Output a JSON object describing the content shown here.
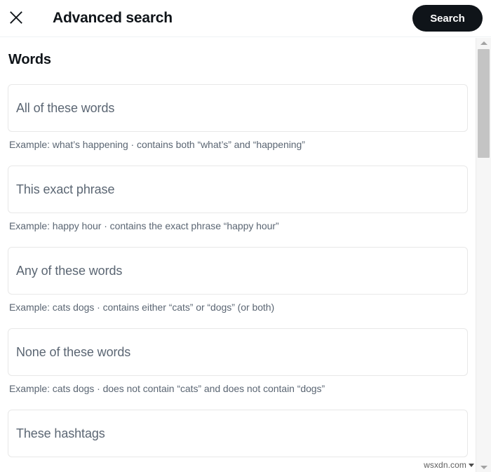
{
  "header": {
    "title": "Advanced search",
    "close_icon": "close-icon",
    "search_button_label": "Search"
  },
  "sections": [
    {
      "title": "Words",
      "fields": [
        {
          "name": "all-of-these-words",
          "placeholder": "All of these words",
          "value": "",
          "hint": "Example: what’s happening · contains both “what’s” and “happening”"
        },
        {
          "name": "this-exact-phrase",
          "placeholder": "This exact phrase",
          "value": "",
          "hint": "Example: happy hour · contains the exact phrase “happy hour”"
        },
        {
          "name": "any-of-these-words",
          "placeholder": "Any of these words",
          "value": "",
          "hint": "Example: cats dogs · contains either “cats” or “dogs” (or both)"
        },
        {
          "name": "none-of-these-words",
          "placeholder": "None of these words",
          "value": "",
          "hint": "Example: cats dogs · does not contain “cats” and does not contain “dogs”"
        },
        {
          "name": "these-hashtags",
          "placeholder": "These hashtags",
          "value": "",
          "hint": ""
        }
      ]
    }
  ],
  "scrollbar": {
    "up_arrow_icon": "triangle-up-icon",
    "down_arrow_icon": "triangle-down-icon"
  },
  "watermark": {
    "text": "wsxdn.com"
  },
  "colors": {
    "accent": "#0f1419",
    "text_primary": "#0f1419",
    "text_secondary": "#5b6673",
    "border": "#e8e8e8",
    "background": "#ffffff"
  }
}
